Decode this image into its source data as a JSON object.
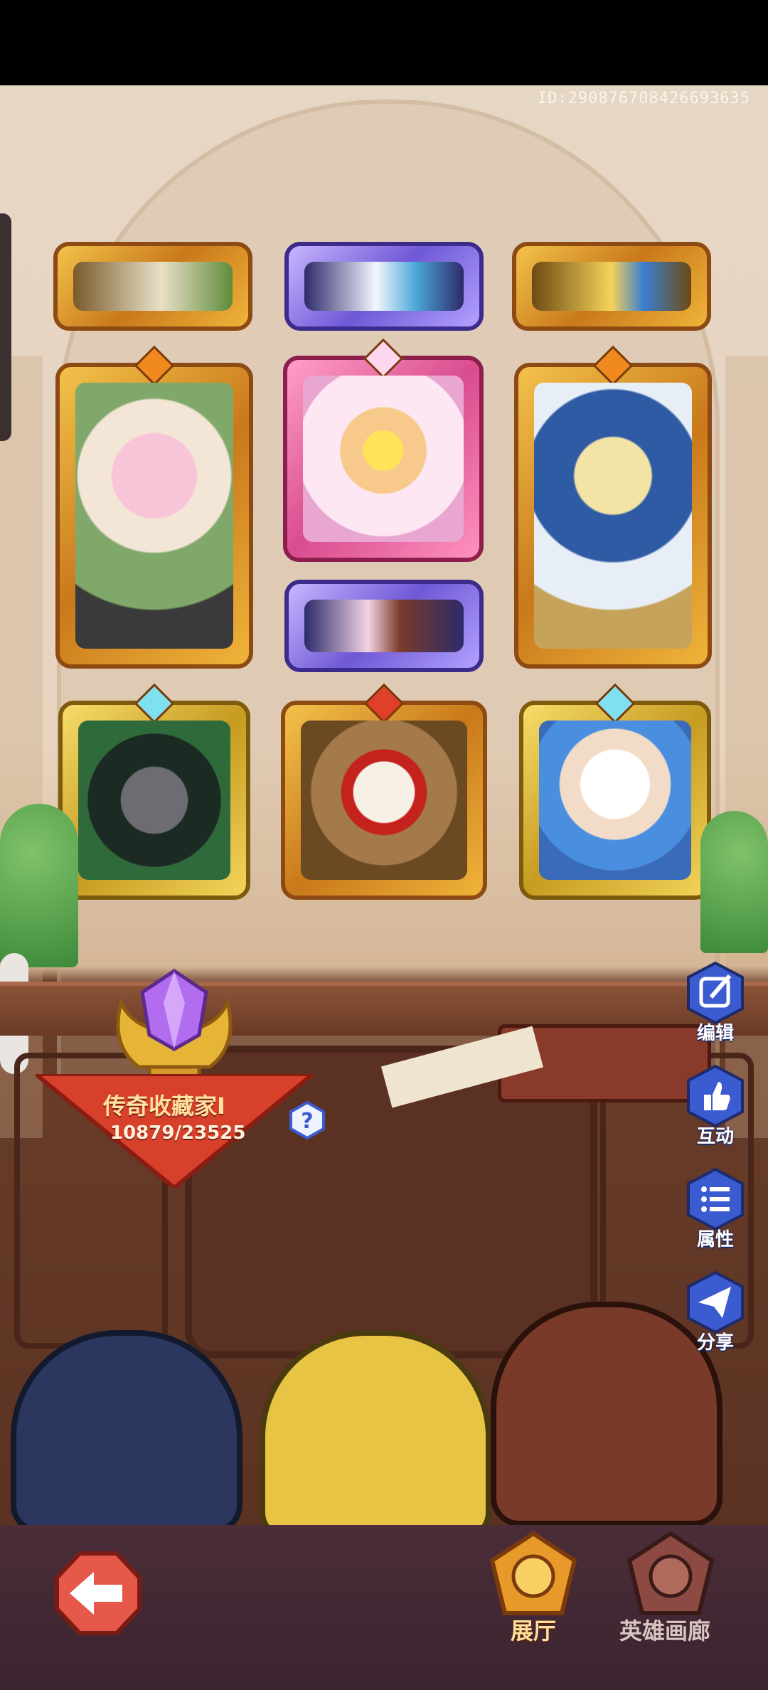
{
  "player_id": "ID:290876708426693635",
  "collector": {
    "title": "传奇收藏家I",
    "progress_current": 10879,
    "progress_total": 23525,
    "progress_text": "10879/23525"
  },
  "side_buttons": [
    {
      "label": "编辑",
      "icon": "edit-icon"
    },
    {
      "label": "互动",
      "icon": "thumbs-up-icon"
    },
    {
      "label": "属性",
      "icon": "list-icon"
    },
    {
      "label": "分享",
      "icon": "send-icon"
    }
  ],
  "bottom_nav": [
    {
      "label": "展厅",
      "active": true
    },
    {
      "label": "英雄画廊",
      "active": false
    }
  ],
  "colors": {
    "gold_frame": "#f3c24a",
    "purple_frame": "#6f58d6",
    "pink_frame": "#d94c8e",
    "button_blue": "#3b5bd1"
  }
}
